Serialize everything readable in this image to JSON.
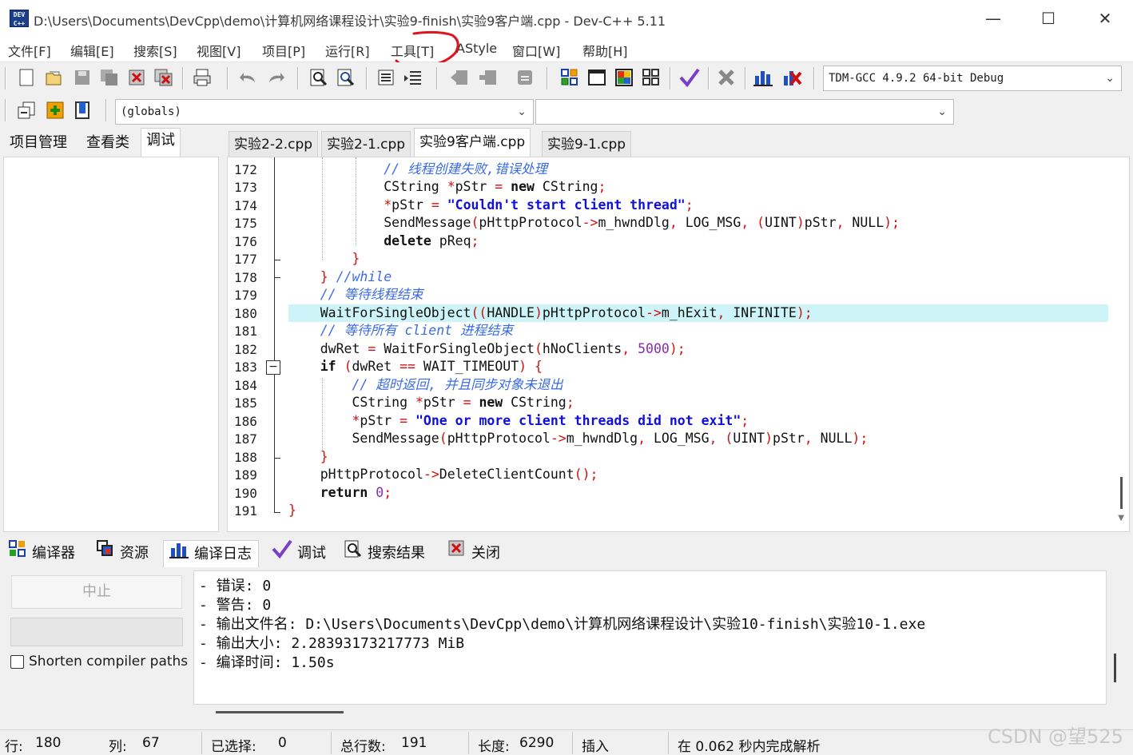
{
  "window": {
    "title": "D:\\Users\\Documents\\DevCpp\\demo\\计算机网络课程设计\\实验9-finish\\实验9客户端.cpp - Dev-C++ 5.11",
    "icon_label": "DEV C++",
    "controls": {
      "minimize": "—",
      "maximize": "☐",
      "close": "✕"
    }
  },
  "menu": {
    "items": [
      "文件[F]",
      "编辑[E]",
      "搜索[S]",
      "视图[V]",
      "项目[P]",
      "运行[R]",
      "工具[T]",
      "AStyle",
      "窗口[W]",
      "帮助[H]"
    ],
    "annotation_color": "#e0141e"
  },
  "toolbar": {
    "compiler_select": "TDM-GCC 4.9.2 64-bit Debug",
    "scope_select": "(globals)",
    "member_select": ""
  },
  "left_panel": {
    "tabs": [
      "项目管理",
      "查看类",
      "调试"
    ],
    "active_tab": 2
  },
  "editor": {
    "file_tabs": [
      "实验2-2.cpp",
      "实验2-1.cpp",
      "实验9客户端.cpp",
      "实验9-1.cpp"
    ],
    "active_tab": 2,
    "highlight_color": "#cdf4f8",
    "line_numbers": [
      "172",
      "173",
      "174",
      "175",
      "176",
      "177",
      "178",
      "179",
      "180",
      "181",
      "182",
      "183",
      "184",
      "185",
      "186",
      "187",
      "188",
      "189",
      "190",
      "191"
    ]
  },
  "bottom_panel": {
    "tabs": [
      {
        "label": "编译器",
        "icon": "grid-icon"
      },
      {
        "label": "资源",
        "icon": "resources-icon"
      },
      {
        "label": "编译日志",
        "icon": "bar-chart-icon"
      },
      {
        "label": "调试",
        "icon": "check-icon"
      },
      {
        "label": "搜索结果",
        "icon": "search-icon"
      },
      {
        "label": "关闭",
        "icon": "close-icon"
      }
    ],
    "active_tab": 2,
    "stop_label": "中止",
    "shorten_label": "Shorten compiler paths",
    "shorten_checked": false,
    "log": [
      "- 错误: 0",
      "- 警告: 0",
      "- 输出文件名: D:\\Users\\Documents\\DevCpp\\demo\\计算机网络课程设计\\实验10-finish\\实验10-1.exe",
      "- 输出大小: 2.28393173217773 MiB",
      "- 编译时间: 1.50s"
    ]
  },
  "status": {
    "row_label": "行:",
    "row": "180",
    "col_label": "列:",
    "col": "67",
    "sel_label": "已选择:",
    "sel": "0",
    "lines_label": "总行数:",
    "lines": "191",
    "len_label": "长度:",
    "len": "6290",
    "mode": "插入",
    "parse_msg": "在 0.062 秒内完成解析"
  },
  "watermark": "CSDN @望525"
}
